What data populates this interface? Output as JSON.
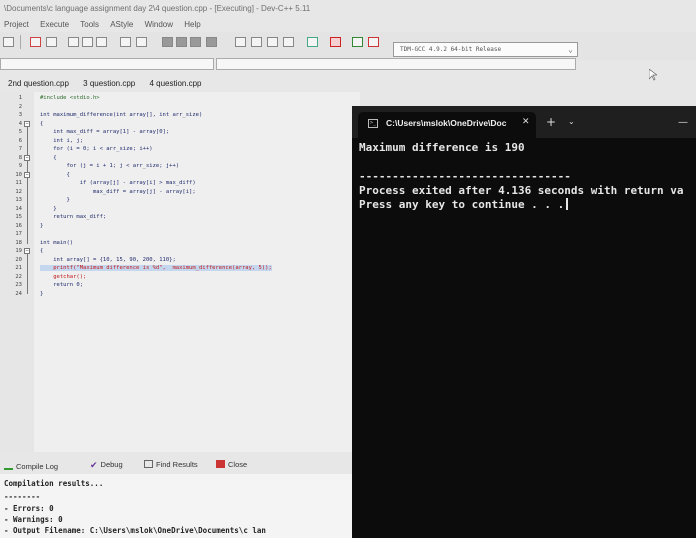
{
  "ide": {
    "title": "\\Documents\\c language assignment day 2\\4 question.cpp - [Executing] - Dev-C++ 5.11",
    "menu": [
      "Project",
      "Execute",
      "Tools",
      "AStyle",
      "Window",
      "Help"
    ],
    "compiler": "TDM-GCC 4.9.2 64-bit Release",
    "tabs": [
      "2nd question.cpp",
      "3 question.cpp",
      "4 question.cpp"
    ],
    "code_lines": [
      "#include <stdio.h>",
      "",
      "int maximum_difference(int array[], int arr_size)",
      "{",
      "    int max_diff = array[1] - array[0];",
      "    int i, j;",
      "    for (i = 0; i < arr_size; i++)",
      "    {",
      "        for (j = i + 1; j < arr_size; j++)",
      "        {",
      "            if (array[j] - array[i] > max_diff)",
      "                max_diff = array[j] - array[i];",
      "        }",
      "    }",
      "    return max_diff;",
      "}",
      "",
      "int main()",
      "{",
      "    int array[] = {10, 15, 90, 200, 110};",
      "    printf(\"Maximum difference is %d\",  maximum_difference(array, 5));",
      "    getchar();",
      "    return 0;",
      "}"
    ],
    "line_numbers": [
      "1",
      "2",
      "3",
      "4",
      "5",
      "6",
      "7",
      "8",
      "9",
      "10",
      "11",
      "12",
      "13",
      "14",
      "15",
      "16",
      "17",
      "18",
      "19",
      "20",
      "21",
      "22",
      "23",
      "24"
    ],
    "bottom_tabs": {
      "compile_log": "Compile Log",
      "debug": "Debug",
      "find_results": "Find Results",
      "close": "Close"
    },
    "output_lines": [
      "Compilation results...",
      "--------",
      "- Errors: 0",
      "- Warnings: 0",
      "- Output Filename: C:\\Users\\mslok\\OneDrive\\Documents\\c lan"
    ]
  },
  "terminal": {
    "tab_title": "C:\\Users\\mslok\\OneDrive\\Doc",
    "lines": [
      "Maximum difference is 190",
      "",
      "--------------------------------",
      "Process exited after 4.136 seconds with return va",
      "Press any key to continue . . ."
    ]
  },
  "colors": {
    "terminal_bg": "#0c0c0c",
    "terminal_text": "#e6e6e6",
    "code_keyword": "#1f2a6b",
    "highlight_line": "#c5d7ef"
  }
}
